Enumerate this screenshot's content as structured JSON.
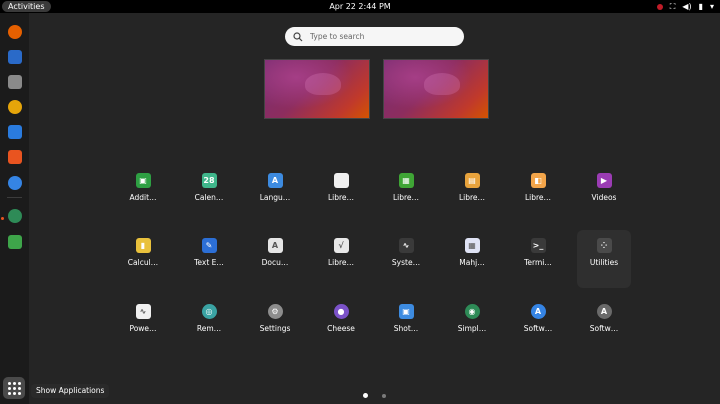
{
  "topbar": {
    "activities": "Activities",
    "clock": "Apr 22  2:44 PM"
  },
  "search": {
    "placeholder": "Type to search"
  },
  "dock": {
    "tooltip": "Show Applications",
    "items": [
      {
        "name": "firefox",
        "color": "#e66000"
      },
      {
        "name": "thunderbird",
        "color": "#2a6ac8"
      },
      {
        "name": "files",
        "color": "#8a8a8a"
      },
      {
        "name": "rhythmbox",
        "color": "#e5a50a"
      },
      {
        "name": "libreoffice-writer",
        "color": "#2a7bde"
      },
      {
        "name": "ubuntu-software",
        "color": "#e95420"
      },
      {
        "name": "help",
        "color": "#3584e4"
      },
      {
        "name": "simple-scan",
        "color": "#2e8b57"
      },
      {
        "name": "recycle",
        "color": "#3ea54a"
      }
    ]
  },
  "apps": [
    {
      "label": "Addit…",
      "icon": "additional-drivers-icon",
      "color": "#2ea043",
      "glyph": "▣"
    },
    {
      "label": "Calen…",
      "icon": "calendar-icon",
      "color": "#3fb68b",
      "glyph": "28"
    },
    {
      "label": "Langu…",
      "icon": "language-icon",
      "color": "#3d8be0",
      "glyph": "A"
    },
    {
      "label": "Libre…",
      "icon": "libreoffice-icon",
      "color": "#f0f0f0",
      "glyph": ""
    },
    {
      "label": "Libre…",
      "icon": "libreoffice-calc-icon",
      "color": "#3fa535",
      "glyph": "▦"
    },
    {
      "label": "Libre…",
      "icon": "libreoffice-impress-icon",
      "color": "#e8a33c",
      "glyph": "▤"
    },
    {
      "label": "Libre…",
      "icon": "libreoffice-draw-icon",
      "color": "#f3a54a",
      "glyph": "◧"
    },
    {
      "label": "Videos",
      "icon": "videos-icon",
      "color": "#9b3cb4",
      "glyph": "▶"
    },
    {
      "label": "Calcul…",
      "icon": "calculator-icon",
      "color": "#e9c13c",
      "glyph": "▮"
    },
    {
      "label": "Text E…",
      "icon": "text-editor-icon",
      "color": "#2c6fd6",
      "glyph": "✎"
    },
    {
      "label": "Docu…",
      "icon": "document-viewer-icon",
      "color": "#e5e5e5",
      "glyph": "A"
    },
    {
      "label": "Libre…",
      "icon": "libreoffice-math-icon",
      "color": "#e8e8e8",
      "glyph": "√"
    },
    {
      "label": "Syste…",
      "icon": "system-monitor-icon",
      "color": "#3a3a3a",
      "glyph": "∿"
    },
    {
      "label": "Mahj…",
      "icon": "mahjongg-icon",
      "color": "#dfe3f5",
      "glyph": "▦"
    },
    {
      "label": "Termi…",
      "icon": "terminal-icon",
      "color": "#3a3a3a",
      "glyph": ">_"
    },
    {
      "label": "Utilities",
      "icon": "utilities-folder-icon",
      "color": "#4a4a4a",
      "glyph": "⁘"
    },
    {
      "label": "Powe…",
      "icon": "power-statistics-icon",
      "color": "#f0f0f0",
      "glyph": "∿"
    },
    {
      "label": "Rem…",
      "icon": "remmina-icon",
      "color": "#3aa3a3",
      "glyph": "◎"
    },
    {
      "label": "Settings",
      "icon": "settings-icon",
      "color": "#8d8d8d",
      "glyph": "⚙"
    },
    {
      "label": "Cheese",
      "icon": "cheese-icon",
      "color": "#7b52c8",
      "glyph": "●"
    },
    {
      "label": "Shot…",
      "icon": "shotwell-icon",
      "color": "#3d8be0",
      "glyph": "▣"
    },
    {
      "label": "Simpl…",
      "icon": "simple-scan-icon",
      "color": "#2e8b57",
      "glyph": "◉"
    },
    {
      "label": "Softw…",
      "icon": "software-updater-icon",
      "color": "#3584e4",
      "glyph": "A"
    },
    {
      "label": "Softw…",
      "icon": "software-properties-icon",
      "color": "#6a6a6a",
      "glyph": "A"
    }
  ],
  "pagination": {
    "pages": 2,
    "current": 1
  }
}
